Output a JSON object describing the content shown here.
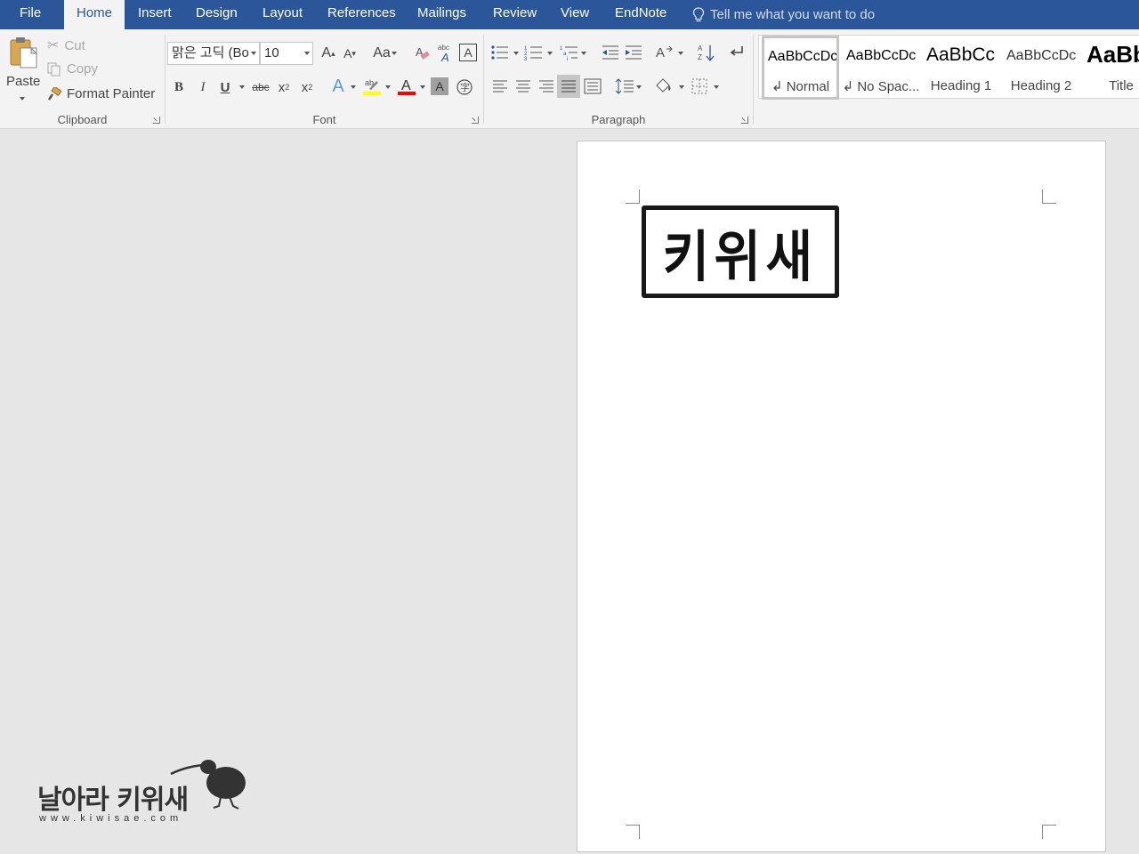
{
  "tabs": [
    {
      "label": "File",
      "active": false
    },
    {
      "label": "Home",
      "active": true
    },
    {
      "label": "Insert",
      "active": false
    },
    {
      "label": "Design",
      "active": false
    },
    {
      "label": "Layout",
      "active": false
    },
    {
      "label": "References",
      "active": false
    },
    {
      "label": "Mailings",
      "active": false
    },
    {
      "label": "Review",
      "active": false
    },
    {
      "label": "View",
      "active": false
    },
    {
      "label": "EndNote",
      "active": false
    }
  ],
  "tell_me": {
    "text": "Tell me what you want to do",
    "icon": "lightbulb-icon"
  },
  "clipboard": {
    "label": "Clipboard",
    "paste_label": "Paste",
    "cut_label": "Cut",
    "copy_label": "Copy",
    "format_painter_label": "Format Painter"
  },
  "font": {
    "label": "Font",
    "font_name": "맑은 고딕 (Bo",
    "font_size": "10",
    "change_case_label": "Aa",
    "colors": {
      "highlight": "#ffff00",
      "font_color": "#ff0000"
    }
  },
  "paragraph": {
    "label": "Paragraph"
  },
  "styles": {
    "items": [
      {
        "preview": "AaBbCcDc",
        "name": "↲ Normal",
        "selected": true
      },
      {
        "preview": "AaBbCcDc",
        "name": "↲ No Spac...",
        "selected": false
      },
      {
        "preview": "AaBbCc",
        "name": "Heading 1",
        "selected": false
      },
      {
        "preview": "AaBbCcDc",
        "name": "Heading 2",
        "selected": false
      },
      {
        "preview": "AaBb",
        "name": "Title",
        "selected": false
      }
    ]
  },
  "document": {
    "stamp_text": "키위새"
  },
  "watermark": {
    "title": "날아라 키위새",
    "url": "www.kiwisae.com"
  },
  "theme": {
    "accent": "#2b579a",
    "ribbon_bg": "#f3f3f3",
    "canvas_bg": "#e6e6e6"
  }
}
